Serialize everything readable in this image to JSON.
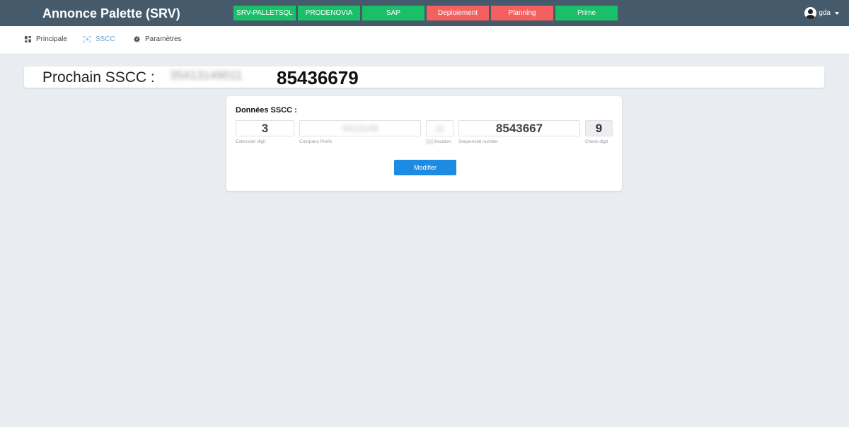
{
  "header": {
    "title": "Annonce Palette (SRV)",
    "status_buttons": [
      {
        "label": "SRV-PALLETSQL",
        "color": "#19c068"
      },
      {
        "label": "PRODENOVIA",
        "color": "#19c068"
      },
      {
        "label": "SAP",
        "color": "#19c068"
      },
      {
        "label": "Deploiement",
        "color": "#f4605f"
      },
      {
        "label": "Planning",
        "color": "#f4605f"
      },
      {
        "label": "Prime",
        "color": "#19c068"
      }
    ],
    "user": {
      "name": "gda",
      "icon": "user-avatar-icon"
    }
  },
  "nav": {
    "items": [
      {
        "label": "Principale",
        "icon": "dashboard-icon",
        "active": false
      },
      {
        "label": "SSCC",
        "icon": "barcode-scan-icon",
        "active": true
      },
      {
        "label": "Paramètres",
        "icon": "gear-icon",
        "active": false
      }
    ]
  },
  "sscc": {
    "label": "Prochain SSCC :",
    "value_obscured": "35413149011",
    "value_visible": "85436679"
  },
  "card": {
    "title": "Données SSCC :",
    "fields": {
      "extension": {
        "value": "3",
        "label": "Extension digit"
      },
      "company_prefix": {
        "value": "5413149",
        "label": "Company Prefix"
      },
      "location": {
        "value": "11",
        "label": "location",
        "label_obscured_prefix": ""
      },
      "sequential": {
        "value": "8543667",
        "label": "Sequencial number"
      },
      "check_digit": {
        "value": "9",
        "label": "Check digit"
      }
    },
    "submit_label": "Modifier"
  },
  "colors": {
    "topbar": "#455a6b",
    "ok": "#19c068",
    "error": "#f4605f",
    "primary": "#1e8be3",
    "nav_active": "#6ea5d8",
    "background": "#e9edf1"
  }
}
